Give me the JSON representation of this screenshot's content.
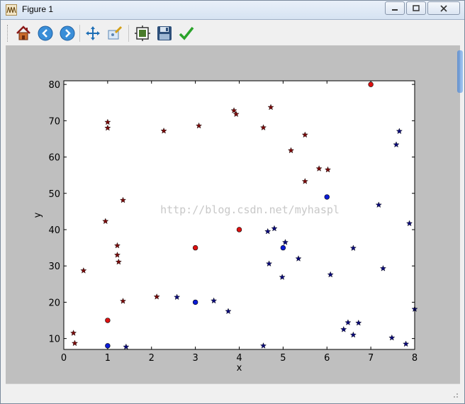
{
  "window": {
    "title": "Figure 1",
    "app_icon": "matplotlib-icon"
  },
  "titlebar_buttons": [
    {
      "name": "minimize-button",
      "icon": "minimize-icon"
    },
    {
      "name": "maximize-button",
      "icon": "maximize-icon"
    },
    {
      "name": "close-button",
      "icon": "close-icon"
    }
  ],
  "toolbar": {
    "buttons": [
      {
        "name": "home-button",
        "icon": "home-icon"
      },
      {
        "name": "back-button",
        "icon": "back-arrow-icon"
      },
      {
        "name": "forward-button",
        "icon": "forward-arrow-icon"
      },
      {
        "name": "pan-button",
        "icon": "move-icon"
      },
      {
        "name": "zoom-button",
        "icon": "zoom-rect-icon"
      },
      {
        "name": "subplots-button",
        "icon": "configure-subplots-icon"
      },
      {
        "name": "save-button",
        "icon": "save-icon"
      },
      {
        "name": "edit-button",
        "icon": "checkmark-icon"
      }
    ]
  },
  "watermark": "http://blog.csdn.net/myhaspl",
  "chart_data": {
    "type": "scatter",
    "xlabel": "x",
    "ylabel": "y",
    "xlim": [
      0,
      8
    ],
    "ylim": [
      7,
      81
    ],
    "xticks": [
      0,
      1,
      2,
      3,
      4,
      5,
      6,
      7,
      8
    ],
    "yticks": [
      10,
      20,
      30,
      40,
      50,
      60,
      70,
      80
    ],
    "grid": false,
    "colors": {
      "dark_red": "#7a0a0a",
      "navy": "#0a0a7a",
      "red": "#dd1111",
      "blue": "#0b1bd6"
    },
    "series": [
      {
        "marker": "star",
        "color": "#7a0a0a",
        "points": [
          [
            0.22,
            11.5
          ],
          [
            0.25,
            8.7
          ],
          [
            0.45,
            28.7
          ],
          [
            0.95,
            42.3
          ],
          [
            1.0,
            69.6
          ],
          [
            1.0,
            68.0
          ],
          [
            1.22,
            35.6
          ],
          [
            1.22,
            33.0
          ],
          [
            1.25,
            31.1
          ],
          [
            1.35,
            48.1
          ],
          [
            1.35,
            20.3
          ],
          [
            2.12,
            21.5
          ],
          [
            2.28,
            67.2
          ],
          [
            3.08,
            68.6
          ],
          [
            3.88,
            72.8
          ],
          [
            3.93,
            71.8
          ],
          [
            4.55,
            68.1
          ],
          [
            4.72,
            73.7
          ],
          [
            5.18,
            61.8
          ],
          [
            5.5,
            66.1
          ],
          [
            5.5,
            53.3
          ],
          [
            5.82,
            56.8
          ],
          [
            6.02,
            56.5
          ]
        ]
      },
      {
        "marker": "star",
        "color": "#0a0a7a",
        "points": [
          [
            1.42,
            7.7
          ],
          [
            2.58,
            21.4
          ],
          [
            3.42,
            20.4
          ],
          [
            3.75,
            17.5
          ],
          [
            4.55,
            8.0
          ],
          [
            4.65,
            39.5
          ],
          [
            4.68,
            30.6
          ],
          [
            4.8,
            40.3
          ],
          [
            4.98,
            26.9
          ],
          [
            5.05,
            36.5
          ],
          [
            5.35,
            32.0
          ],
          [
            6.08,
            27.6
          ],
          [
            6.38,
            12.5
          ],
          [
            6.48,
            14.4
          ],
          [
            6.6,
            34.9
          ],
          [
            6.6,
            11.0
          ],
          [
            6.72,
            14.3
          ],
          [
            7.18,
            46.8
          ],
          [
            7.28,
            29.3
          ],
          [
            7.48,
            10.2
          ],
          [
            7.58,
            63.4
          ],
          [
            7.65,
            67.1
          ],
          [
            7.8,
            8.5
          ],
          [
            7.88,
            41.7
          ],
          [
            8.0,
            18.1
          ]
        ]
      },
      {
        "marker": "circle",
        "color": "#dd1111",
        "points": [
          [
            1.0,
            15.0
          ],
          [
            3.0,
            35.0
          ],
          [
            4.0,
            40.0
          ],
          [
            7.0,
            80.0
          ]
        ]
      },
      {
        "marker": "circle",
        "color": "#0b1bd6",
        "points": [
          [
            1.0,
            8.0
          ],
          [
            3.0,
            20.0
          ],
          [
            5.0,
            35.0
          ],
          [
            6.0,
            49.0
          ]
        ]
      }
    ]
  }
}
